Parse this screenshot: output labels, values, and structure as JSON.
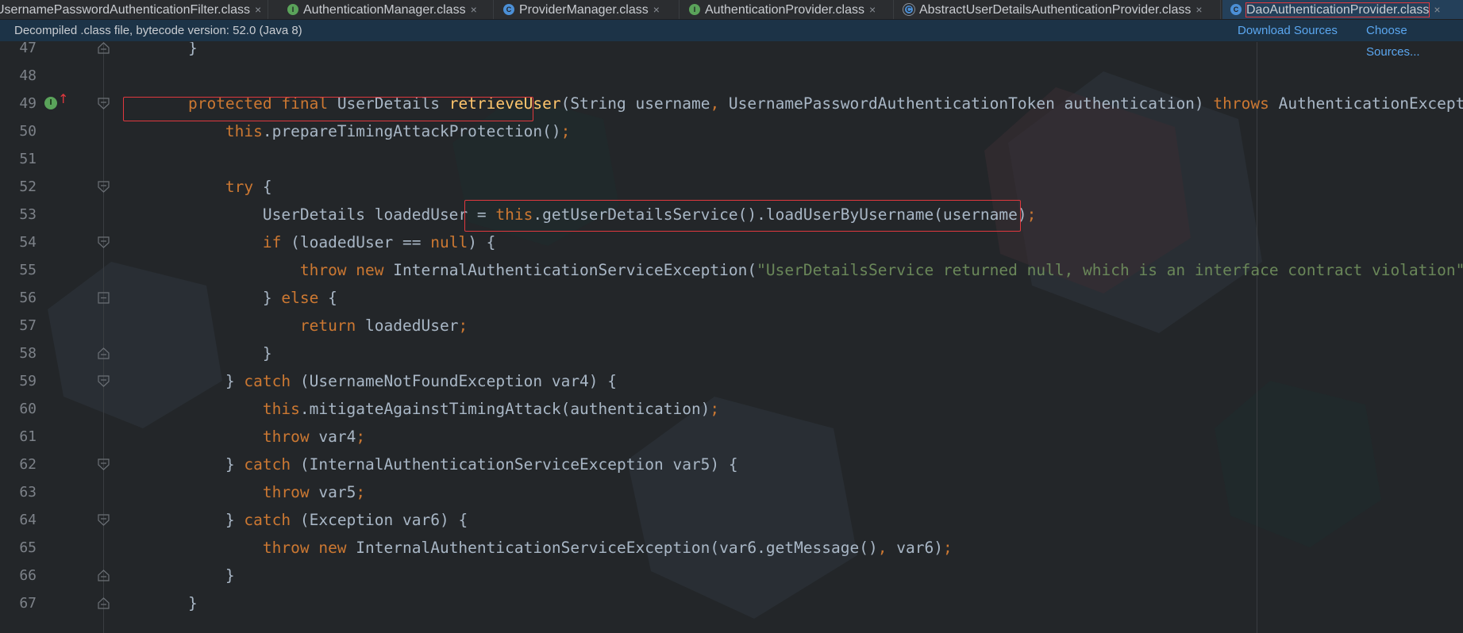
{
  "tabs": [
    {
      "label": "UsernamePasswordAuthenticationFilter.class",
      "icon": "class-icon",
      "kind": "clazz"
    },
    {
      "label": "AuthenticationManager.class",
      "icon": "interface-icon",
      "kind": "iface"
    },
    {
      "label": "ProviderManager.class",
      "icon": "class-icon",
      "kind": "clazz"
    },
    {
      "label": "AuthenticationProvider.class",
      "icon": "interface-icon",
      "kind": "iface"
    },
    {
      "label": "AbstractUserDetailsAuthenticationProvider.class",
      "icon": "abstract-class-icon",
      "kind": "abs"
    },
    {
      "label": "DaoAuthenticationProvider.class",
      "icon": "class-icon",
      "kind": "clazz",
      "active": true
    }
  ],
  "infobar": {
    "message": "Decompiled .class file, bytecode version: 52.0 (Java 8)",
    "download_sources": "Download Sources",
    "choose_sources": "Choose Sources..."
  },
  "editor": {
    "lines": [
      {
        "num": "47",
        "fold": "end",
        "tokens": [
          [
            "",
            "    }"
          ]
        ]
      },
      {
        "num": "48",
        "tokens": []
      },
      {
        "num": "49",
        "fold": "start",
        "gutter": "implements-override",
        "tokens": [
          [
            "",
            "    "
          ],
          [
            "kw",
            "protected final "
          ],
          [
            "",
            "UserDetails "
          ],
          [
            "fn",
            "retrieveUser"
          ],
          [
            "",
            "(String username"
          ],
          [
            "kw",
            ", "
          ],
          [
            "",
            "UsernamePasswordAuthenticationToken authentication) "
          ],
          [
            "kw",
            "throws "
          ],
          [
            "",
            "AuthenticationException {"
          ]
        ]
      },
      {
        "num": "50",
        "tokens": [
          [
            "",
            "        "
          ],
          [
            "kw",
            "this"
          ],
          [
            "",
            ".prepareTimingAttackProtection()"
          ],
          [
            "kw",
            ";"
          ]
        ]
      },
      {
        "num": "51",
        "tokens": []
      },
      {
        "num": "52",
        "fold": "start",
        "tokens": [
          [
            "",
            "        "
          ],
          [
            "kw",
            "try "
          ],
          [
            "",
            "{"
          ]
        ]
      },
      {
        "num": "53",
        "tokens": [
          [
            "",
            "            UserDetails loadedUser = "
          ],
          [
            "kw",
            "this"
          ],
          [
            "",
            ".getUserDetailsService().loadUserByUsername(username)"
          ],
          [
            "kw",
            ";"
          ]
        ]
      },
      {
        "num": "54",
        "fold": "start",
        "tokens": [
          [
            "",
            "            "
          ],
          [
            "kw",
            "if "
          ],
          [
            "",
            "(loadedUser == "
          ],
          [
            "kw",
            "null"
          ],
          [
            "",
            ") {"
          ]
        ]
      },
      {
        "num": "55",
        "tokens": [
          [
            "",
            "                "
          ],
          [
            "kw",
            "throw new "
          ],
          [
            "",
            "InternalAuthenticationServiceException("
          ],
          [
            "str",
            "\"UserDetailsService returned null, which is an interface contract violation\""
          ],
          [
            "",
            ");"
          ]
        ]
      },
      {
        "num": "56",
        "fold": "mid",
        "tokens": [
          [
            "",
            "            } "
          ],
          [
            "kw",
            "else "
          ],
          [
            "",
            "{"
          ]
        ]
      },
      {
        "num": "57",
        "tokens": [
          [
            "",
            "                "
          ],
          [
            "kw",
            "return "
          ],
          [
            "",
            "loadedUser"
          ],
          [
            "kw",
            ";"
          ]
        ]
      },
      {
        "num": "58",
        "fold": "end",
        "tokens": [
          [
            "",
            "            }"
          ]
        ]
      },
      {
        "num": "59",
        "fold": "start",
        "tokens": [
          [
            "",
            "        } "
          ],
          [
            "kw",
            "catch "
          ],
          [
            "",
            "(UsernameNotFoundException var4) {"
          ]
        ]
      },
      {
        "num": "60",
        "tokens": [
          [
            "",
            "            "
          ],
          [
            "kw",
            "this"
          ],
          [
            "",
            ".mitigateAgainstTimingAttack(authentication)"
          ],
          [
            "kw",
            ";"
          ]
        ]
      },
      {
        "num": "61",
        "tokens": [
          [
            "",
            "            "
          ],
          [
            "kw",
            "throw "
          ],
          [
            "",
            "var4"
          ],
          [
            "kw",
            ";"
          ]
        ]
      },
      {
        "num": "62",
        "fold": "start",
        "tokens": [
          [
            "",
            "        } "
          ],
          [
            "kw",
            "catch "
          ],
          [
            "",
            "(InternalAuthenticationServiceException var5) {"
          ]
        ]
      },
      {
        "num": "63",
        "tokens": [
          [
            "",
            "            "
          ],
          [
            "kw",
            "throw "
          ],
          [
            "",
            "var5"
          ],
          [
            "kw",
            ";"
          ]
        ]
      },
      {
        "num": "64",
        "fold": "start",
        "tokens": [
          [
            "",
            "        } "
          ],
          [
            "kw",
            "catch "
          ],
          [
            "",
            "(Exception var6) {"
          ]
        ]
      },
      {
        "num": "65",
        "tokens": [
          [
            "",
            "            "
          ],
          [
            "kw",
            "throw new "
          ],
          [
            "",
            "InternalAuthenticationServiceException(var6.getMessage()"
          ],
          [
            "kw",
            ", "
          ],
          [
            "",
            "var6)"
          ],
          [
            "kw",
            ";"
          ]
        ]
      },
      {
        "num": "66",
        "fold": "end",
        "tokens": [
          [
            "",
            "        }"
          ]
        ]
      },
      {
        "num": "67",
        "fold": "end",
        "tokens": [
          [
            "",
            "    }"
          ]
        ]
      }
    ]
  },
  "colors": {
    "background": "#232629",
    "keyword": "#cc7832",
    "string": "#6a8759",
    "method": "#ffc66d",
    "text": "#a9b7c6",
    "highlight_box": "#e0383e",
    "link": "#5ba7f0"
  }
}
